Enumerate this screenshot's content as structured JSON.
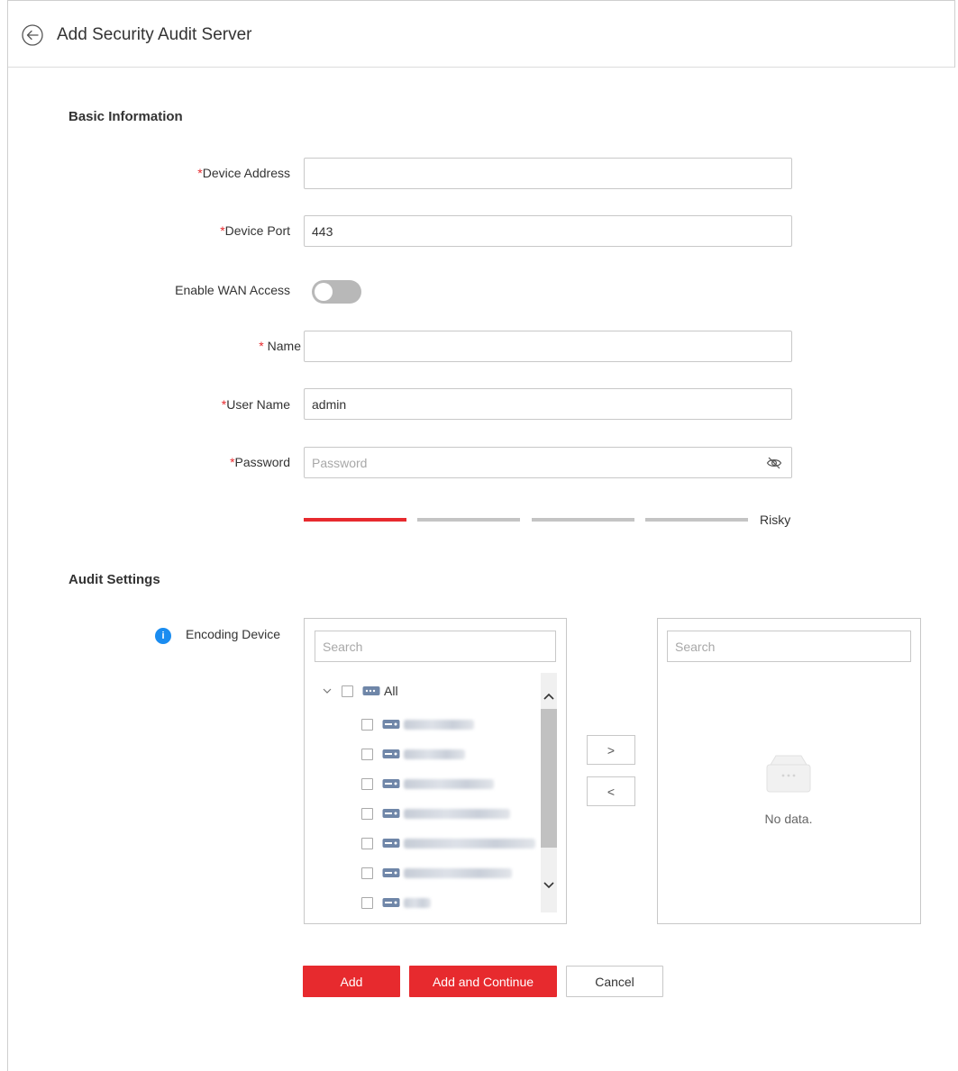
{
  "header": {
    "title": "Add Security Audit Server"
  },
  "sections": {
    "basic": "Basic Information",
    "audit": "Audit Settings"
  },
  "fields": {
    "device_address": {
      "required_mark": "*",
      "label": "Device Address",
      "value": ""
    },
    "device_port": {
      "required_mark": "*",
      "label": "Device Port",
      "value": "443"
    },
    "wan": {
      "label": "Enable WAN Access",
      "enabled": false
    },
    "name": {
      "required_mark": "* ",
      "label": "Name",
      "value": ""
    },
    "user_name": {
      "required_mark": "*",
      "label": "User Name",
      "value": "admin"
    },
    "password": {
      "required_mark": "*",
      "label": "Password",
      "value": "",
      "placeholder": "Password"
    }
  },
  "password_strength": {
    "level": 1,
    "of": 4,
    "text": "Risky",
    "active_color": "#e72a2e",
    "inactive_color": "#c4c4c4"
  },
  "encoding_device": {
    "label": "Encoding Device",
    "info_icon": "info-icon",
    "source": {
      "search_placeholder": "Search",
      "root": {
        "label": "All",
        "checked": false,
        "expanded": true
      },
      "items_note": "device names blurred in original"
    },
    "target": {
      "search_placeholder": "Search",
      "empty_text": "No data."
    },
    "move_right": ">",
    "move_left": "<"
  },
  "buttons": {
    "add": "Add",
    "add_continue": "Add and Continue",
    "cancel": "Cancel"
  },
  "colors": {
    "accent": "#e72a2e",
    "info": "#1a8cf0",
    "toggle_off": "#b8b8b8"
  }
}
